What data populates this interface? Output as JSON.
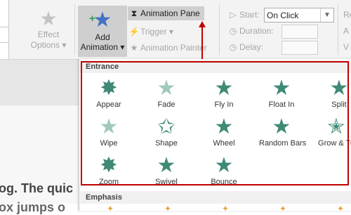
{
  "ribbon": {
    "effect_options_label_1": "Effect",
    "effect_options_label_2": "Options",
    "add_animation_label_1": "Add",
    "add_animation_label_2": "Animation",
    "animation_pane_label": "Animation Pane",
    "trigger_label": "Trigger",
    "animation_painter_label": "Animation Painter",
    "timing": {
      "start_label": "Start:",
      "start_value": "On Click",
      "duration_label": "Duration:",
      "delay_label": "Delay:"
    },
    "reorder_label_1": "Re",
    "reorder_label_2": "A",
    "reorder_label_3": "V"
  },
  "gallery": {
    "entrance_header": "Entrance",
    "emphasis_header": "Emphasis",
    "entrance_items": [
      {
        "label": "Appear",
        "icon": "appear-star-icon"
      },
      {
        "label": "Fade",
        "icon": "fade-star-icon"
      },
      {
        "label": "Fly In",
        "icon": "fly-in-star-icon"
      },
      {
        "label": "Float In",
        "icon": "float-in-star-icon"
      },
      {
        "label": "Split",
        "icon": "split-star-icon"
      },
      {
        "label": "Wipe",
        "icon": "wipe-star-icon"
      },
      {
        "label": "Shape",
        "icon": "shape-star-icon"
      },
      {
        "label": "Wheel",
        "icon": "wheel-star-icon"
      },
      {
        "label": "Random Bars",
        "icon": "random-bars-star-icon"
      },
      {
        "label": "Grow & Tu",
        "icon": "grow-turn-star-icon"
      },
      {
        "label": "Zoom",
        "icon": "zoom-star-icon"
      },
      {
        "label": "Swivel",
        "icon": "swivel-star-icon"
      },
      {
        "label": "Bounce",
        "icon": "bounce-star-icon"
      }
    ]
  },
  "slide": {
    "text_line_1": "og. The quic",
    "text_line_2": "ox jumps o"
  },
  "colors": {
    "highlight": "#c00000",
    "star_green": "#3f8a76",
    "add_star_blue": "#4472c4"
  }
}
